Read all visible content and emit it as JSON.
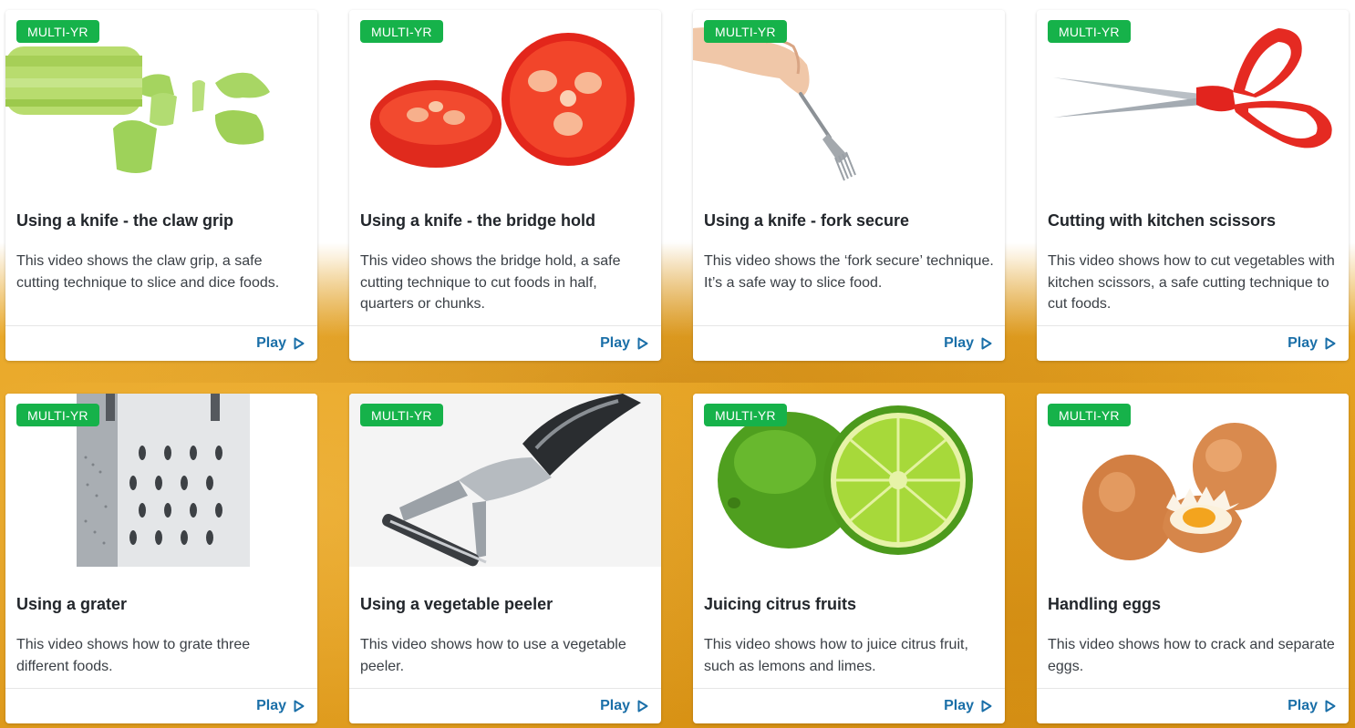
{
  "cards": [
    {
      "badge": "MULTI-YR",
      "title": "Using a knife - the claw grip",
      "description": "This video shows the claw grip, a safe cutting technique to slice and dice foods.",
      "play_label": "Play",
      "image": "celery"
    },
    {
      "badge": "MULTI-YR",
      "title": "Using a knife - the bridge hold",
      "description": "This video shows the bridge hold, a safe cutting technique to cut foods in half, quarters or chunks.",
      "play_label": "Play",
      "image": "tomato"
    },
    {
      "badge": "MULTI-YR",
      "title": "Using a knife - fork secure",
      "description": "This video shows the ‘fork secure’ technique. It’s a safe way to slice food.",
      "play_label": "Play",
      "image": "fork"
    },
    {
      "badge": "MULTI-YR",
      "title": "Cutting with kitchen scissors",
      "description": "This video shows how to cut vegetables with kitchen scissors, a safe cutting technique to cut foods.",
      "play_label": "Play",
      "image": "scissors"
    },
    {
      "badge": "MULTI-YR",
      "title": "Using a grater",
      "description": "This video shows how to grate three different foods.",
      "play_label": "Play",
      "image": "grater"
    },
    {
      "badge": "MULTI-YR",
      "title": "Using a vegetable peeler",
      "description": "This video shows how to use a vegetable peeler.",
      "play_label": "Play",
      "image": "peeler"
    },
    {
      "badge": "MULTI-YR",
      "title": "Juicing citrus fruits",
      "description": "This video shows how to juice citrus fruit, such as lemons and limes.",
      "play_label": "Play",
      "image": "lime"
    },
    {
      "badge": "MULTI-YR",
      "title": "Handling eggs",
      "description": "This video shows how to crack and separate eggs.",
      "play_label": "Play",
      "image": "eggs"
    }
  ],
  "colors": {
    "badge": "#16b24a",
    "link": "#1a6fa8",
    "title": "#22262b",
    "background": "#e8a51f"
  }
}
